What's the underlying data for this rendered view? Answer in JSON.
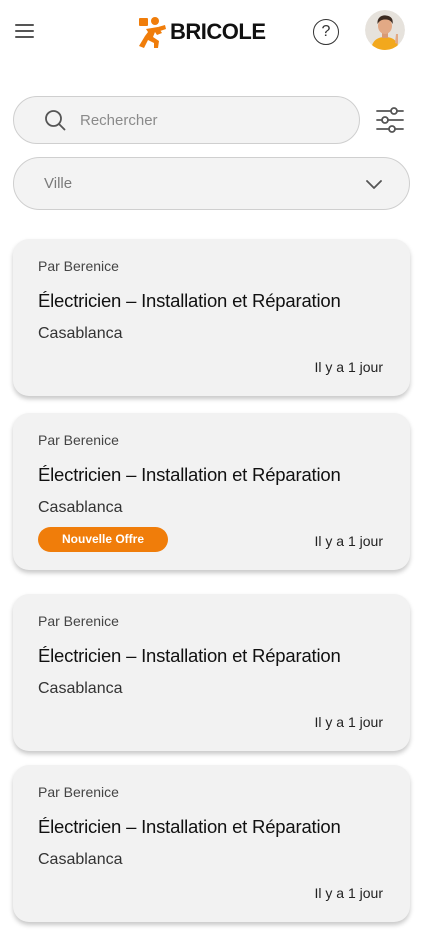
{
  "header": {
    "brand": "BRICOLE",
    "help_symbol": "?",
    "menu_icon": "hamburger-icon",
    "avatar_icon": "user-avatar"
  },
  "search": {
    "placeholder": "Rechercher",
    "value": ""
  },
  "filter": {
    "city_placeholder": "Ville"
  },
  "colors": {
    "accent": "#f07d0a",
    "card_bg": "#f2f2f2",
    "input_bg": "#f3f3f3"
  },
  "listings": [
    {
      "author": "Par Berenice",
      "title": "Électricien – Installation et Réparation",
      "city": "Casablanca",
      "time": "Il y a 1 jour",
      "badge": ""
    },
    {
      "author": "Par Berenice",
      "title": "Électricien – Installation et Réparation",
      "city": "Casablanca",
      "time": "Il y a 1 jour",
      "badge": "Nouvelle Offre"
    },
    {
      "author": "Par Berenice",
      "title": "Électricien – Installation et Réparation",
      "city": "Casablanca",
      "time": "Il y a 1 jour",
      "badge": ""
    },
    {
      "author": "Par Berenice",
      "title": "Électricien – Installation et Réparation",
      "city": "Casablanca",
      "time": "Il y a 1 jour",
      "badge": ""
    }
  ]
}
